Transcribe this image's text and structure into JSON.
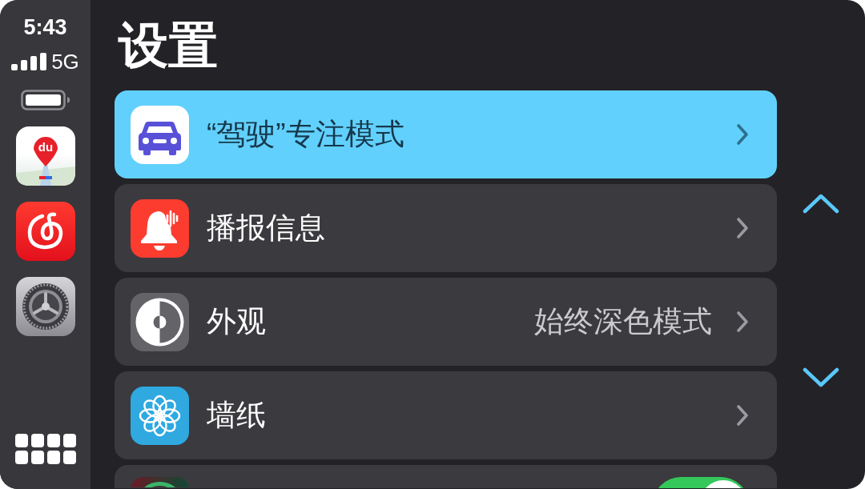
{
  "status_bar": {
    "time": "5:43",
    "network": "5G"
  },
  "dock": {
    "apps": [
      {
        "kind": "maps",
        "logo_text": "du"
      },
      {
        "kind": "music"
      },
      {
        "kind": "settings"
      }
    ]
  },
  "title": "设置",
  "rows": [
    {
      "kind": "link",
      "label": "“驾驶”专注模式",
      "selected": true
    },
    {
      "kind": "link",
      "label": "播报信息",
      "selected": false
    },
    {
      "kind": "link",
      "label": "外观",
      "value": "始终深色模式",
      "selected": false
    },
    {
      "kind": "link",
      "label": "墙纸",
      "selected": false
    },
    {
      "kind": "toggle",
      "on": true,
      "selected": false
    }
  ]
}
